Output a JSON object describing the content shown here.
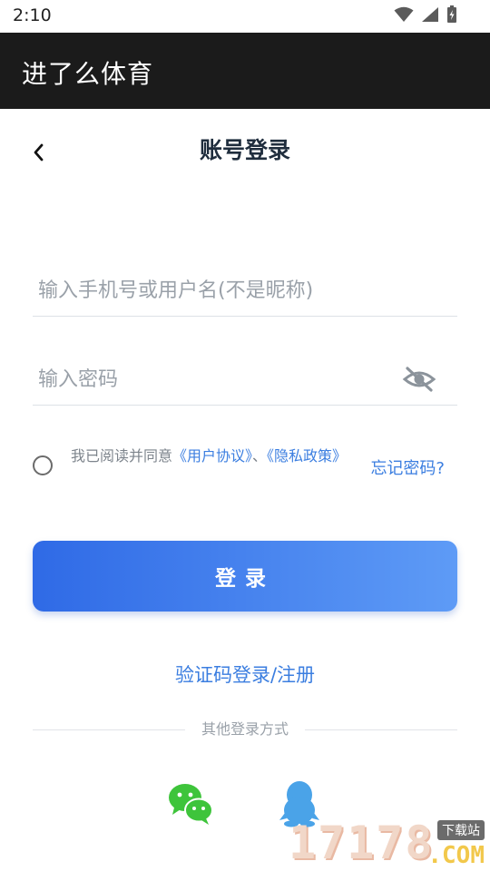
{
  "status_bar": {
    "time": "2:10",
    "icons": [
      "wifi-icon",
      "cell-signal-icon",
      "battery-charging-icon"
    ]
  },
  "app_bar": {
    "title": "进了么体育"
  },
  "page": {
    "title": "账号登录",
    "back_icon": "chevron-left-icon"
  },
  "form": {
    "username_placeholder": "输入手机号或用户名(不是昵称)",
    "username_value": "",
    "password_placeholder": "输入密码",
    "password_value": "",
    "password_visibility_icon": "eye-off-icon"
  },
  "agreement": {
    "prefix": "我已阅读并同意",
    "user_agreement": "《用户协议》",
    "separator": "、",
    "privacy_policy": "《隐私政策》",
    "checked": false
  },
  "forgot_password": "忘记密码?",
  "login_button": "登录",
  "sms_login": "验证码登录/注册",
  "other_login": {
    "label": "其他登录方式",
    "providers": [
      {
        "name": "wechat",
        "icon": "wechat-icon",
        "color": "#3ec43b"
      },
      {
        "name": "qq",
        "icon": "qq-penguin-icon",
        "color": "#4aa3e8"
      }
    ]
  },
  "watermark": {
    "digits": "17178",
    "tag": "下载站",
    "suffix": ".COM"
  },
  "colors": {
    "accent": "#3b7ee0",
    "app_bar": "#1b1b1b",
    "button_start": "#2f6ae6",
    "button_end": "#5e9bf6"
  }
}
